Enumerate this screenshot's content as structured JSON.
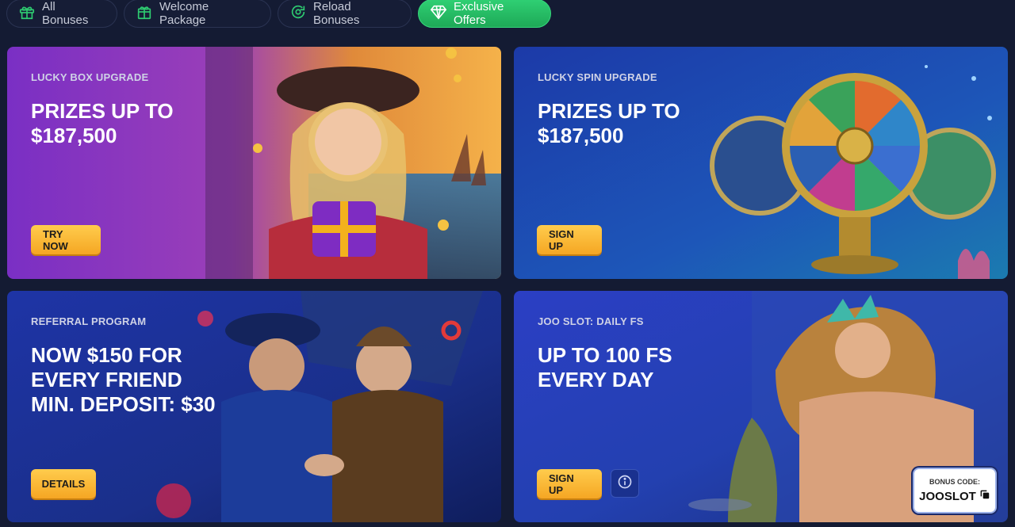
{
  "tabs": [
    {
      "label": "All Bonuses",
      "icon": "gift-icon",
      "active": false
    },
    {
      "label": "Welcome Package",
      "icon": "gift-box-icon",
      "active": false
    },
    {
      "label": "Reload Bonuses",
      "icon": "reload-icon",
      "active": false
    },
    {
      "label": "Exclusive Offers",
      "icon": "diamond-icon",
      "active": true
    }
  ],
  "cards": [
    {
      "eyebrow": "LUCKY BOX UPGRADE",
      "headline": "PRIZES UP TO\n$187,500",
      "button": "TRY NOW"
    },
    {
      "eyebrow": "LUCKY SPIN UPGRADE",
      "headline": "PRIZES UP TO\n$187,500",
      "button": "SIGN UP"
    },
    {
      "eyebrow": "REFERRAL PROGRAM",
      "headline": "NOW $150 FOR\nEVERY FRIEND\nMIN. DEPOSIT: $30",
      "button": "DETAILS"
    },
    {
      "eyebrow": "JOO SLOT: DAILY FS",
      "headline": "UP TO 100 FS\nEVERY DAY",
      "button": "SIGN UP",
      "bonus_code_label": "BONUS CODE:",
      "bonus_code": "JOOSLOT"
    }
  ],
  "colors": {
    "page_bg": "#141b33",
    "active_tab": "#2fcf73",
    "button": "#f5a623"
  }
}
